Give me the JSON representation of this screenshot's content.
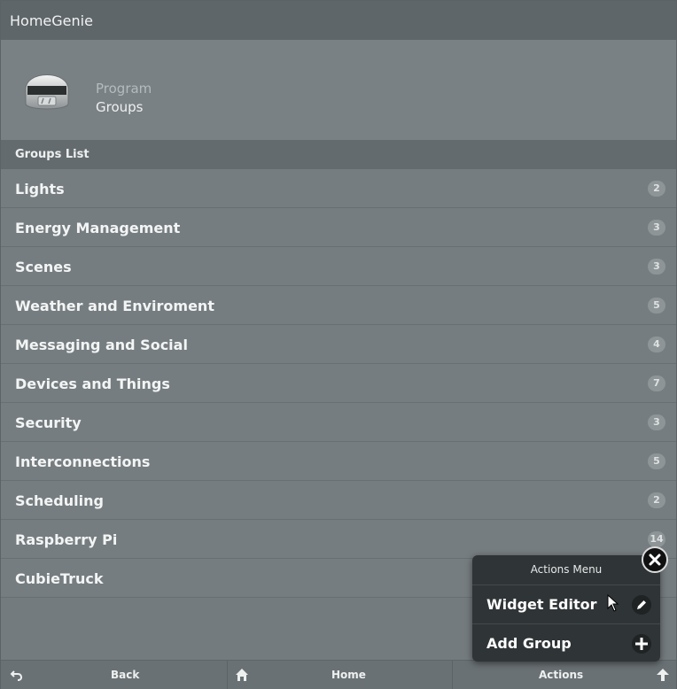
{
  "app": {
    "title": "HomeGenie"
  },
  "header": {
    "subtitle": "Program",
    "title": "Groups"
  },
  "section": {
    "title": "Groups List"
  },
  "groups": [
    {
      "label": "Lights",
      "count": "2"
    },
    {
      "label": "Energy Management",
      "count": "3"
    },
    {
      "label": "Scenes",
      "count": "3"
    },
    {
      "label": "Weather and Enviroment",
      "count": "5"
    },
    {
      "label": "Messaging and Social",
      "count": "4"
    },
    {
      "label": "Devices and Things",
      "count": "7"
    },
    {
      "label": "Security",
      "count": "3"
    },
    {
      "label": "Interconnections",
      "count": "5"
    },
    {
      "label": "Scheduling",
      "count": "2"
    },
    {
      "label": "Raspberry Pi",
      "count": "14"
    },
    {
      "label": "CubieTruck",
      "count": ""
    }
  ],
  "footer": {
    "back_label": "Back",
    "home_label": "Home",
    "actions_label": "Actions"
  },
  "actions_menu": {
    "title": "Actions Menu",
    "items": [
      {
        "label": "Widget Editor",
        "icon": "pencil-icon"
      },
      {
        "label": "Add Group",
        "icon": "plus-icon"
      }
    ]
  },
  "icons": {
    "back": "undo-icon",
    "home": "home-icon",
    "up": "arrow-up-icon",
    "close": "close-icon",
    "avatar": "helmet-icon"
  }
}
